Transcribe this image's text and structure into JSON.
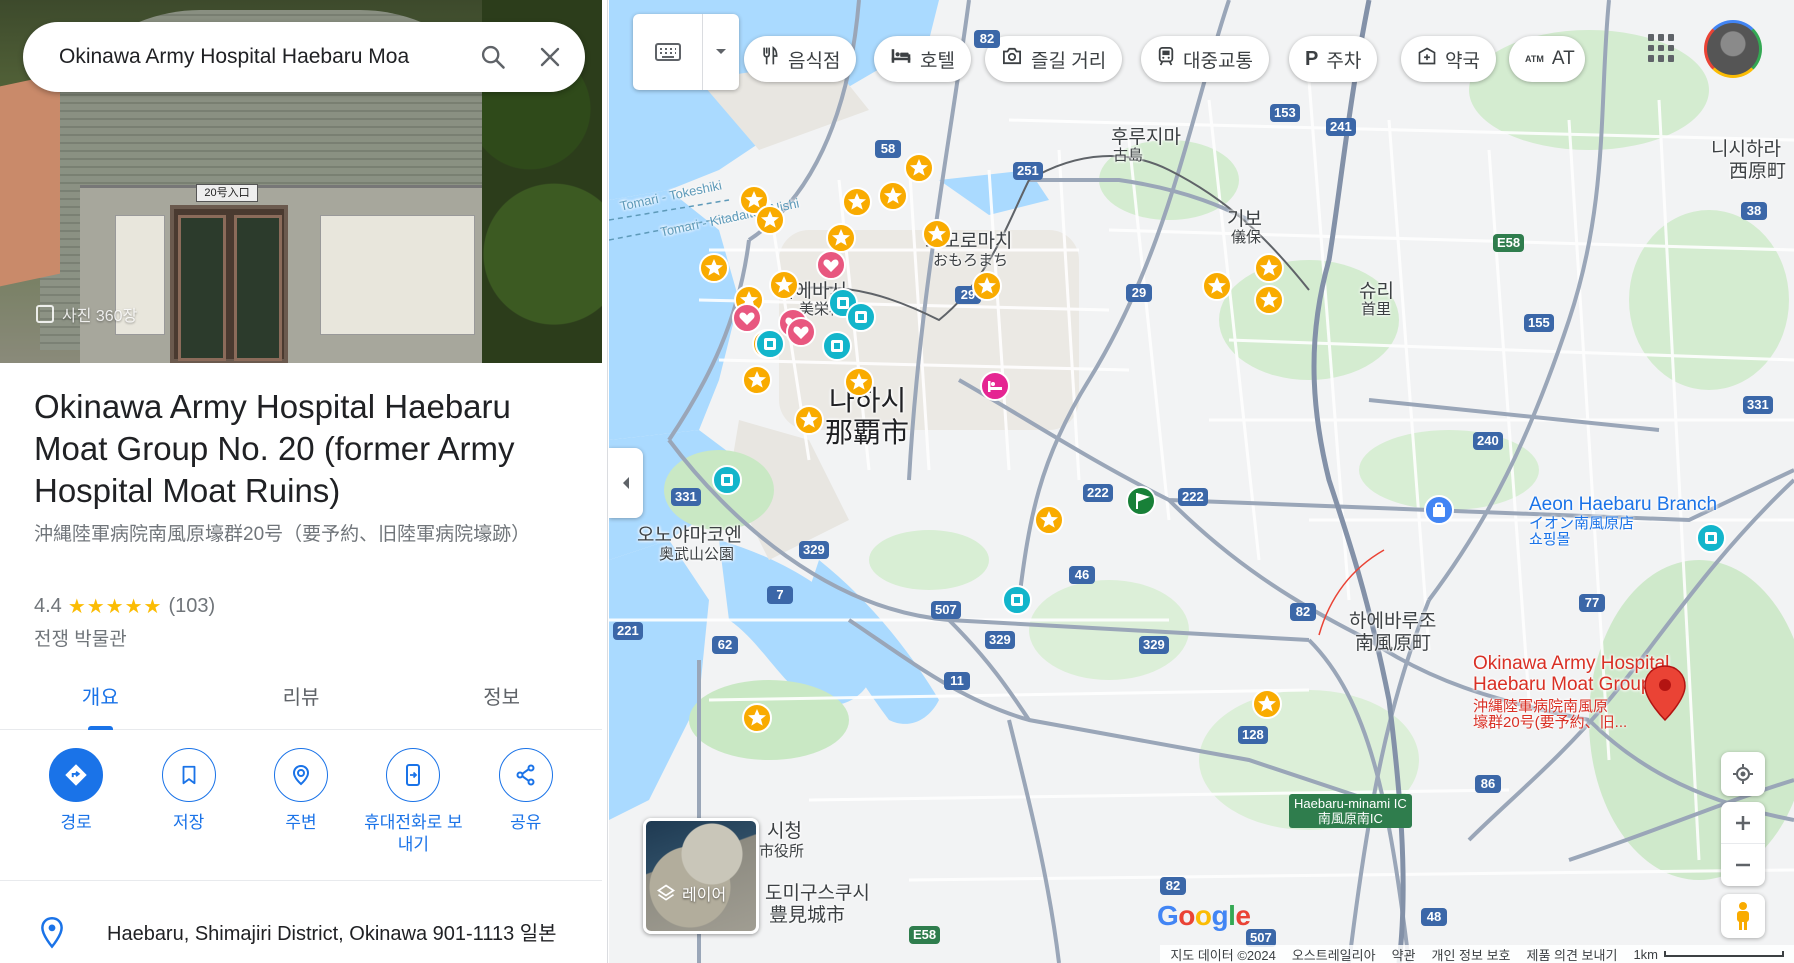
{
  "search": {
    "value": "Okinawa Army Hospital Haebaru Moa"
  },
  "photo": {
    "count_label": "사진 360장",
    "door_sign": "20号入口"
  },
  "place": {
    "title": "Okinawa Army Hospital Haebaru Moat Group No. 20 (former Army Hospital Moat Ruins)",
    "subtitle": "沖縄陸軍病院南風原壕群20号（要予約、旧陸軍病院壕跡）",
    "rating": "4.4",
    "stars": "★★★★★",
    "review_count": "(103)",
    "category": "전쟁 박물관",
    "tabs": [
      {
        "label": "개요"
      },
      {
        "label": "리뷰"
      },
      {
        "label": "정보"
      }
    ],
    "actions": [
      {
        "label": "경로",
        "icon": "directions-icon"
      },
      {
        "label": "저장",
        "icon": "bookmark-icon"
      },
      {
        "label": "주변",
        "icon": "nearby-icon"
      },
      {
        "label": "휴대전화로 보내기",
        "icon": "send-to-phone-icon"
      },
      {
        "label": "공유",
        "icon": "share-icon"
      }
    ],
    "address": "Haebaru, Shimajiri District, Okinawa 901-1113 일본"
  },
  "map": {
    "chips": [
      {
        "label": "음식점",
        "icon": "restaurant-icon"
      },
      {
        "label": "호텔",
        "icon": "hotel-icon"
      },
      {
        "label": "즐길 거리",
        "icon": "camera-icon"
      },
      {
        "label": "대중교통",
        "icon": "transit-icon"
      },
      {
        "label": "주차",
        "icon": "parking-icon"
      },
      {
        "label": "약국",
        "icon": "pharmacy-icon"
      },
      {
        "label": "AT",
        "icon": "atm-icon"
      }
    ],
    "labels": {
      "naha_ko": "나하시",
      "naha_ja": "那覇市",
      "omoromachi": "오모로마치",
      "omoromachi_ja": "おもろまち",
      "miebashi": "미에바시",
      "miebashi_ja": "美栄橋",
      "furujima": "후루지마",
      "furujima_ja": "古島",
      "gibo": "기보",
      "gibo_ja": "儀保",
      "shuri": "슈리",
      "shuri_ja": "首里",
      "nishihara": "니시하라",
      "nishihara_ja": "西原町",
      "onoyama": "오노야마코엔",
      "onoyama_ja": "奥武山公園",
      "haebaru": "하에바루조",
      "haebaru_ja": "南風原町",
      "tomigusuku": "도미구스쿠시",
      "tomigusuku_ja": "豊見城市",
      "shi": "시청",
      "shiyakusho": "市役所",
      "aeon": "Aeon Haebaru Branch",
      "aeon_ja": "イオン南風原店",
      "aeon_type": "쇼핑몰",
      "place_line1": "Okinawa Army Hospital",
      "place_line2": "Haebaru Moat Group...",
      "place_ja1": "沖縄陸軍病院南風原",
      "place_ja2": "壕群20号(要予約、旧...",
      "ic_line1": "Haebaru-minami IC",
      "ic_line2": "南風原南IC",
      "tomari1": "Tomari - Tokeshiki",
      "tomari2": "Tomari - Kitadaito - Nishi",
      "layer": "레이어"
    },
    "shields": [
      "82",
      "58",
      "153",
      "241",
      "251",
      "29",
      "29",
      "38",
      "E58",
      "155",
      "331",
      "240",
      "222",
      "222",
      "331",
      "329",
      "46",
      "507",
      "329",
      "82",
      "329",
      "77",
      "221",
      "62",
      "7",
      "11",
      "128",
      "86",
      "82",
      "507",
      "48",
      "E58"
    ],
    "footer": {
      "data": "지도 데이터 ©2024",
      "australia": "오스트레일리아",
      "terms": "약관",
      "privacy": "개인 정보 보호",
      "feedback": "제품 의견 보내기",
      "scale": "1km"
    },
    "logo": "Google"
  },
  "colors": {
    "accent": "#1a73e8",
    "pin": "#ea4335",
    "star": "#fbbc04",
    "road": "#ffffff",
    "water": "#aadaff",
    "park": "#c9e8c4"
  }
}
